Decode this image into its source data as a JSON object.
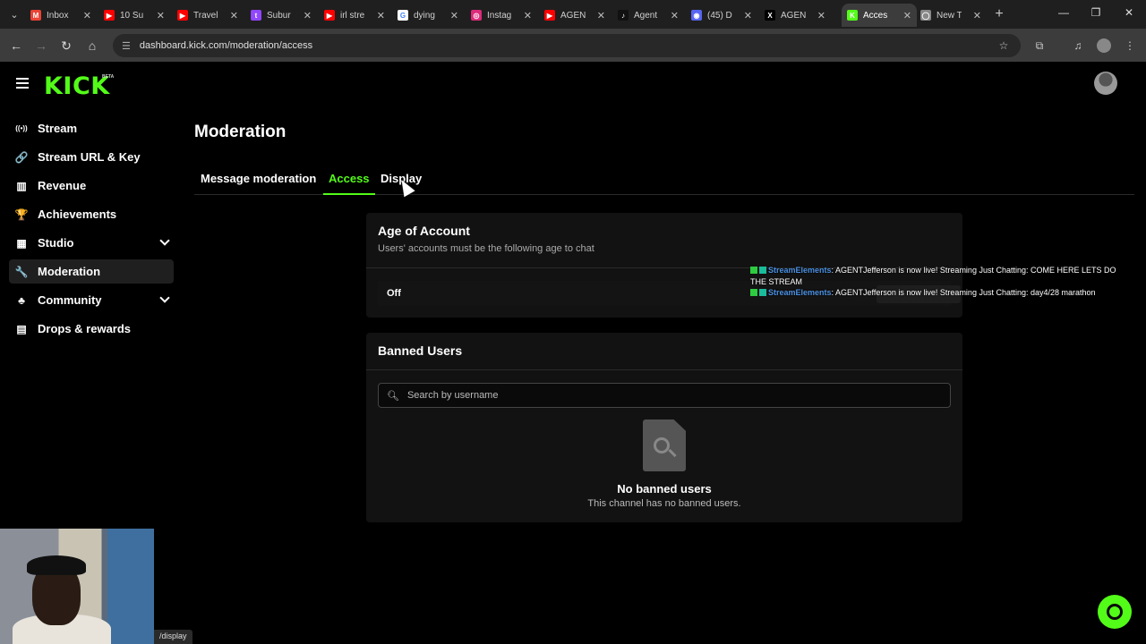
{
  "browser": {
    "tabs": [
      {
        "title": "Inbox",
        "favicon": "gmail-icon",
        "color": "#ea4335",
        "glyph": "M",
        "active": false
      },
      {
        "title": "10 Su",
        "favicon": "youtube-icon",
        "color": "#ff0000",
        "glyph": "▶",
        "active": false
      },
      {
        "title": "Travel",
        "favicon": "youtube-icon",
        "color": "#ff0000",
        "glyph": "▶",
        "active": false
      },
      {
        "title": "Subur",
        "favicon": "twitch-icon",
        "color": "#9146ff",
        "glyph": "t",
        "active": false
      },
      {
        "title": "irl stre",
        "favicon": "youtube-icon",
        "color": "#ff0000",
        "glyph": "▶",
        "active": false
      },
      {
        "title": "dying",
        "favicon": "google-icon",
        "color": "#ffffff",
        "glyph": "G",
        "active": false
      },
      {
        "title": "Instag",
        "favicon": "instagram-icon",
        "color": "#dd2a7b",
        "glyph": "◎",
        "active": false
      },
      {
        "title": "AGEN",
        "favicon": "youtube-icon",
        "color": "#ff0000",
        "glyph": "▶",
        "active": false
      },
      {
        "title": "Agent",
        "favicon": "tiktok-icon",
        "color": "#111111",
        "glyph": "♪",
        "active": false
      },
      {
        "title": "(45) D",
        "favicon": "discord-icon",
        "color": "#5865f2",
        "glyph": "◉",
        "active": false
      },
      {
        "title": "AGEN",
        "favicon": "x-icon",
        "color": "#000000",
        "glyph": "X",
        "active": false
      },
      {
        "title": "Acces",
        "favicon": "kick-icon",
        "color": "#53fc18",
        "glyph": "K",
        "active": true
      },
      {
        "title": "New T",
        "favicon": "chrome-icon",
        "color": "#888888",
        "glyph": "◯",
        "active": false
      }
    ],
    "url": "dashboard.kick.com/moderation/access",
    "status_url": "/display"
  },
  "app": {
    "logo_text": "KICK",
    "logo_badge": "BETA",
    "accent_color": "#53fc18"
  },
  "sidebar": {
    "items": [
      {
        "label": "Stream",
        "icon": "broadcast-icon",
        "glyph": "((•))",
        "expandable": false,
        "active": false
      },
      {
        "label": "Stream URL & Key",
        "icon": "link-icon",
        "glyph": "🔗",
        "expandable": false,
        "active": false
      },
      {
        "label": "Revenue",
        "icon": "chart-icon",
        "glyph": "▥",
        "expandable": false,
        "active": false
      },
      {
        "label": "Achievements",
        "icon": "trophy-icon",
        "glyph": "🏆",
        "expandable": false,
        "active": false
      },
      {
        "label": "Studio",
        "icon": "studio-icon",
        "glyph": "▦",
        "expandable": true,
        "active": false
      },
      {
        "label": "Moderation",
        "icon": "wrench-icon",
        "glyph": "🔧",
        "expandable": false,
        "active": true
      },
      {
        "label": "Community",
        "icon": "community-icon",
        "glyph": "♣",
        "expandable": true,
        "active": false
      },
      {
        "label": "Drops & rewards",
        "icon": "gift-icon",
        "glyph": "▤",
        "expandable": false,
        "active": false
      }
    ]
  },
  "main": {
    "title": "Moderation",
    "tabs": [
      {
        "label": "Message moderation",
        "active": false
      },
      {
        "label": "Access",
        "active": true
      },
      {
        "label": "Display",
        "active": false
      }
    ],
    "age_card": {
      "title": "Age of Account",
      "subtitle": "Users' accounts must be the following age to chat",
      "value": "Off"
    },
    "banned_card": {
      "title": "Banned Users",
      "search_placeholder": "Search by username",
      "empty_title": "No banned users",
      "empty_subtitle": "This channel has no banned users."
    }
  },
  "overlay_chat": [
    {
      "user": "StreamElements",
      "text": ": AGENTJefferson is now live! Streaming Just Chatting: COME HERE LETS DO THE STREAM"
    },
    {
      "user": "StreamElements",
      "text": ": AGENTJefferson is now live! Streaming Just Chatting: day4/28 marathon"
    }
  ]
}
